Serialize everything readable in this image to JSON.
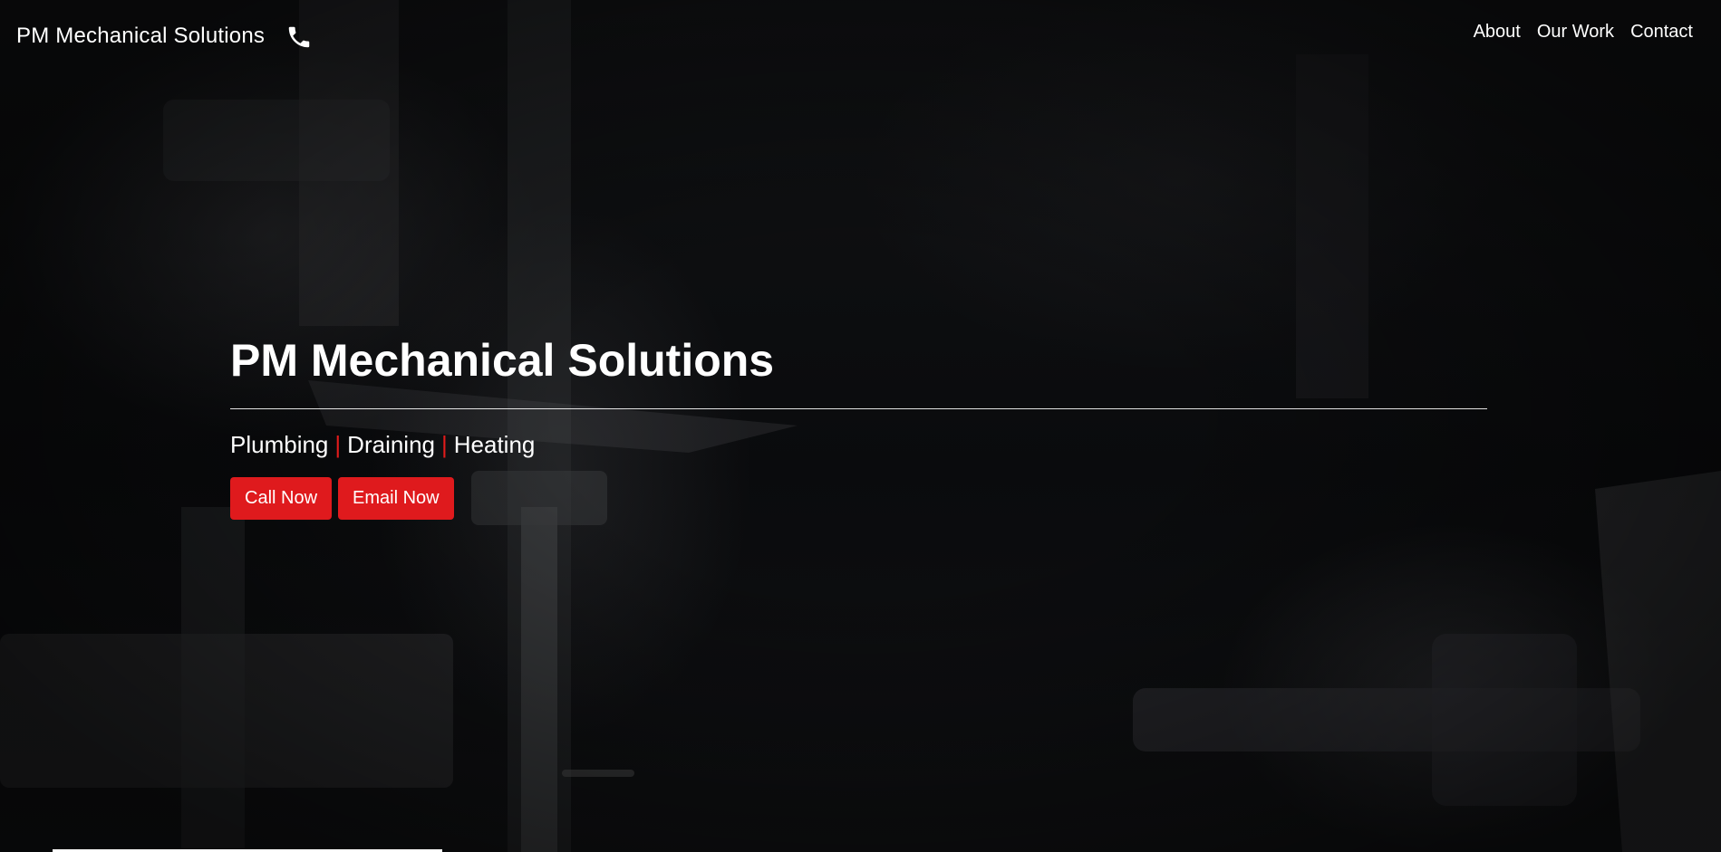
{
  "navbar": {
    "brand": "PM Mechanical Solutions",
    "phone_icon": "phone-icon",
    "links": [
      {
        "label": "About"
      },
      {
        "label": "Our Work"
      },
      {
        "label": "Contact"
      }
    ]
  },
  "hero": {
    "title_bold": "PM",
    "title_rest": " Mechanical Solutions",
    "services": [
      "Plumbing",
      "Draining",
      "Heating"
    ],
    "separator": "|",
    "buttons": {
      "call": "Call Now",
      "email": "Email Now"
    }
  },
  "colors": {
    "accent": "#df1a1d",
    "text": "#ffffff",
    "background": "#0b0c0e"
  }
}
